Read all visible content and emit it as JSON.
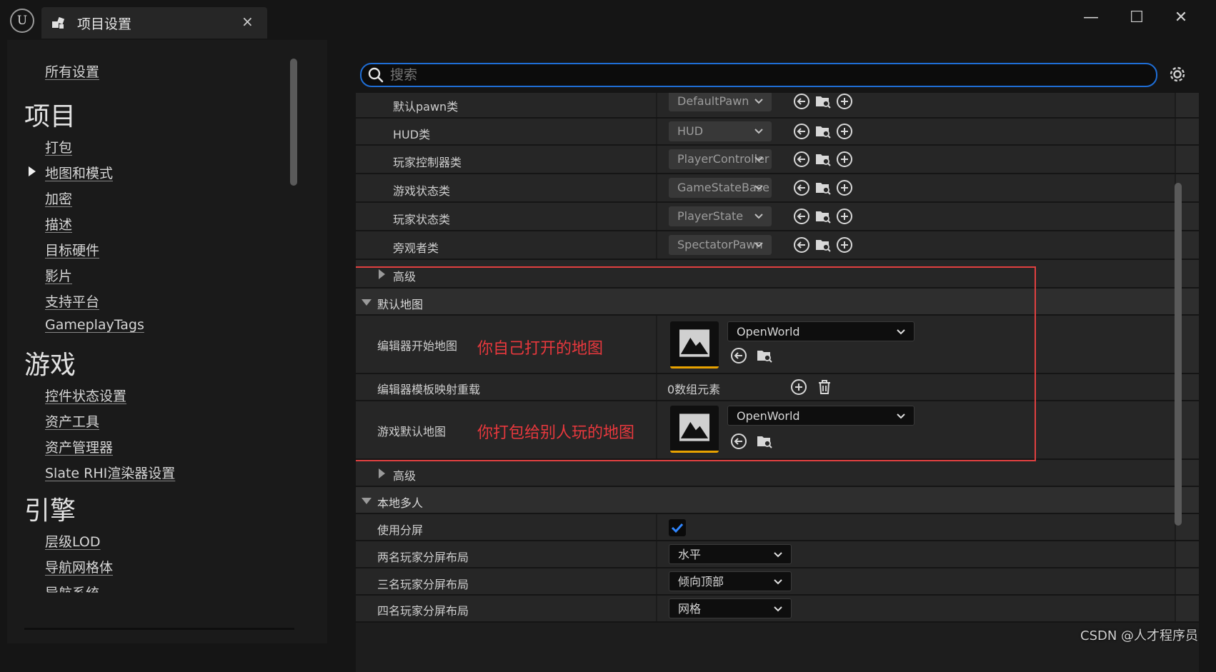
{
  "window": {
    "tab_title": "项目设置",
    "tab_close": "×",
    "min_label": "—",
    "max_label": "☐",
    "close_label": "✕"
  },
  "sidebar": {
    "all_settings": "所有设置",
    "categories": [
      {
        "title": "项目",
        "items": [
          "打包",
          "地图和模式",
          "加密",
          "描述",
          "目标硬件",
          "影片",
          "支持平台",
          "GameplayTags"
        ]
      },
      {
        "title": "游戏",
        "items": [
          "控件状态设置",
          "资产工具",
          "资产管理器",
          "Slate RHI渲染器设置"
        ]
      },
      {
        "title": "引擎",
        "items": [
          "层级LOD",
          "导航网格体",
          "导航系统"
        ]
      }
    ],
    "selected_item": "地图和模式"
  },
  "search": {
    "placeholder": "搜索"
  },
  "properties": {
    "game_mode_rows": [
      {
        "label": "默认pawn类",
        "value": "DefaultPawn"
      },
      {
        "label": "HUD类",
        "value": "HUD"
      },
      {
        "label": "玩家控制器类",
        "value": "PlayerController"
      },
      {
        "label": "游戏状态类",
        "value": "GameStateBase"
      },
      {
        "label": "玩家状态类",
        "value": "PlayerState"
      },
      {
        "label": "旁观者类",
        "value": "SpectatorPawn"
      }
    ],
    "advanced_1": "高级",
    "default_maps": {
      "section_title": "默认地图",
      "editor_startup_map_label": "编辑器开始地图",
      "editor_startup_map_value": "OpenWorld",
      "editor_startup_annotation": "你自己打开的地图",
      "editor_template_label": "编辑器模板映射重载",
      "editor_template_value": "0数组元素",
      "game_default_map_label": "游戏默认地图",
      "game_default_map_value": "OpenWorld",
      "game_default_annotation": "你打包给别人玩的地图",
      "advanced_label": "高级"
    },
    "local_multiplayer": {
      "section_title": "本地多人",
      "use_splitscreen_label": "使用分屏",
      "use_splitscreen_checked": true,
      "two_player_label": "两名玩家分屏布局",
      "two_player_value": "水平",
      "three_player_label": "三名玩家分屏布局",
      "three_player_value": "倾向顶部",
      "four_player_label": "四名玩家分屏布局",
      "four_player_value": "网格"
    }
  },
  "watermark": "CSDN @人才程序员",
  "colors": {
    "accent": "#1f6ed6",
    "annotation": "#e8383d",
    "thumbnail_underline": "#e8a200"
  }
}
